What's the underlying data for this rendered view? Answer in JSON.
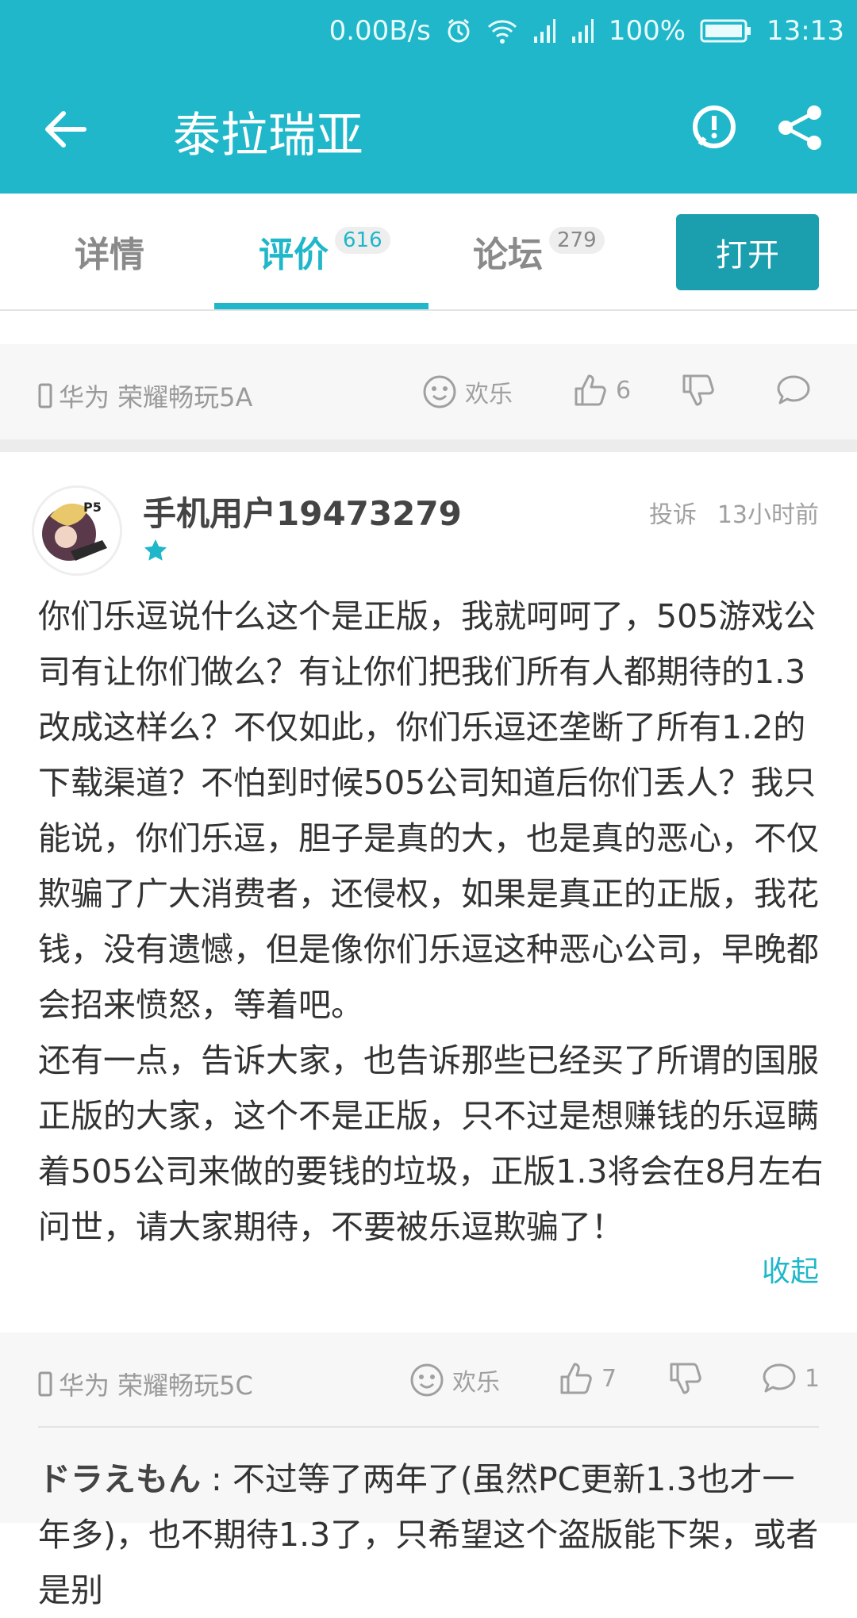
{
  "status_bar": {
    "net_speed": "0.00B/s",
    "battery": "100%",
    "time": "13:13",
    "icons": [
      "alarm-icon",
      "wifi-icon",
      "signal-icon",
      "signal-icon",
      "battery-icon"
    ]
  },
  "header": {
    "title": "泰拉瑞亚",
    "back_icon": "arrow-left-icon",
    "report_icon": "exclamation-circle-icon",
    "share_icon": "share-icon",
    "background_color": "#1fb7c9"
  },
  "tabs": [
    {
      "label": "详情",
      "badge": ""
    },
    {
      "label": "评价",
      "badge": "616",
      "active": true
    },
    {
      "label": "论坛",
      "badge": "279"
    }
  ],
  "open_button": {
    "label": "打开",
    "color": "#1b9fae"
  },
  "previous_review_meta": {
    "device": "华为 荣耀畅玩5A",
    "mood": "欢乐",
    "likes": "6",
    "comments": ""
  },
  "review": {
    "username": "手机用户19473279",
    "stars": 1,
    "complain_label": "投诉",
    "time": "13小时前",
    "paragraphs": [
      "你们乐逗说什么这个是正版，我就呵呵了，505游戏公司有让你们做么？有让你们把我们所有人都期待的1.3改成这样么？不仅如此，你们乐逗还垄断了所有1.2的下载渠道？不怕到时候505公司知道后你们丢人？我只能说，你们乐逗，胆子是真的大，也是真的恶心，不仅欺骗了广大消费者，还侵权，如果是真正的正版，我花钱，没有遗憾，但是像你们乐逗这种恶心公司，早晚都会招来愤怒，等着吧。",
      "还有一点，告诉大家，也告诉那些已经买了所谓的国服正版的大家，这个不是正版，只不过是想赚钱的乐逗瞒着505公司来做的要钱的垃圾，正版1.3将会在8月左右问世，请大家期待，不要被乐逗欺骗了！"
    ],
    "collapse_label": "收起",
    "meta": {
      "device": "华为 荣耀畅玩5C",
      "mood": "欢乐",
      "likes": "7",
      "comments": "1"
    }
  },
  "reply": {
    "name": "ドラえもん",
    "separator": " : ",
    "text": "不过等了两年了(虽然PC更新1.3也才一年多)，也不期待1.3了，只希望这个盗版能下架，或者是别"
  },
  "accent_color": "#1fb7c9"
}
